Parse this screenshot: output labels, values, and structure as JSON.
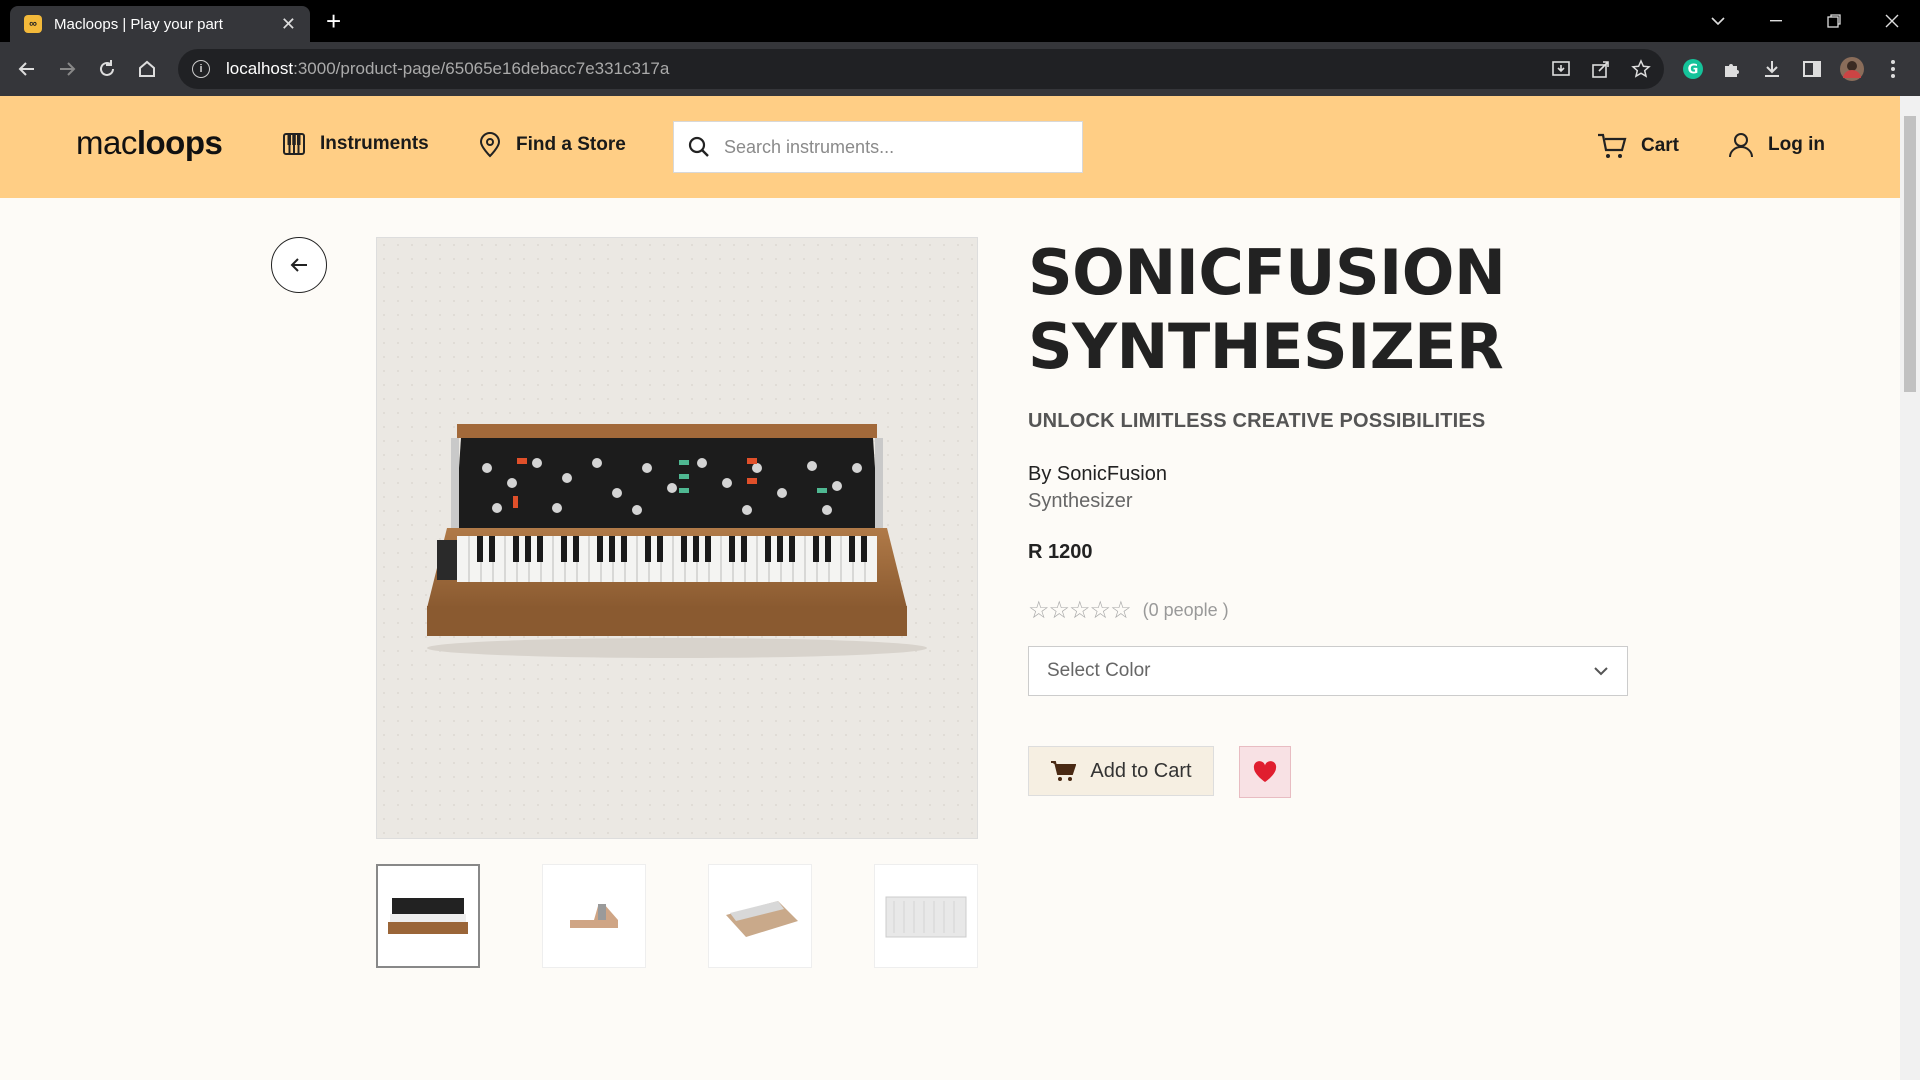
{
  "browser": {
    "tab_title": "Macloops | Play your part",
    "favicon_text": "∞",
    "url_host": "localhost",
    "url_path": ":3000/product-page/65065e16debacc7e331c317a"
  },
  "header": {
    "logo_prefix": "mac",
    "logo_suffix": "loops",
    "nav_instruments": "Instruments",
    "nav_find_store": "Find a Store",
    "search_placeholder": "Search instruments...",
    "cart_label": "Cart",
    "login_label": "Log in"
  },
  "product": {
    "title_line1": "SONICFUSION",
    "title_line2": "SYNTHESIZER",
    "tagline": "UNLOCK LIMITLESS CREATIVE POSSIBILITIES",
    "brand": "By SonicFusion",
    "category": "Synthesizer",
    "price": "R 1200",
    "rating_stars": "☆☆☆☆☆",
    "rating_value": 0,
    "rating_count": "(0 people )",
    "color_placeholder": "Select Color",
    "add_to_cart_label": "Add to Cart"
  },
  "colors": {
    "header_bg": "#ffce85",
    "wish_heart": "#e01e2f"
  }
}
